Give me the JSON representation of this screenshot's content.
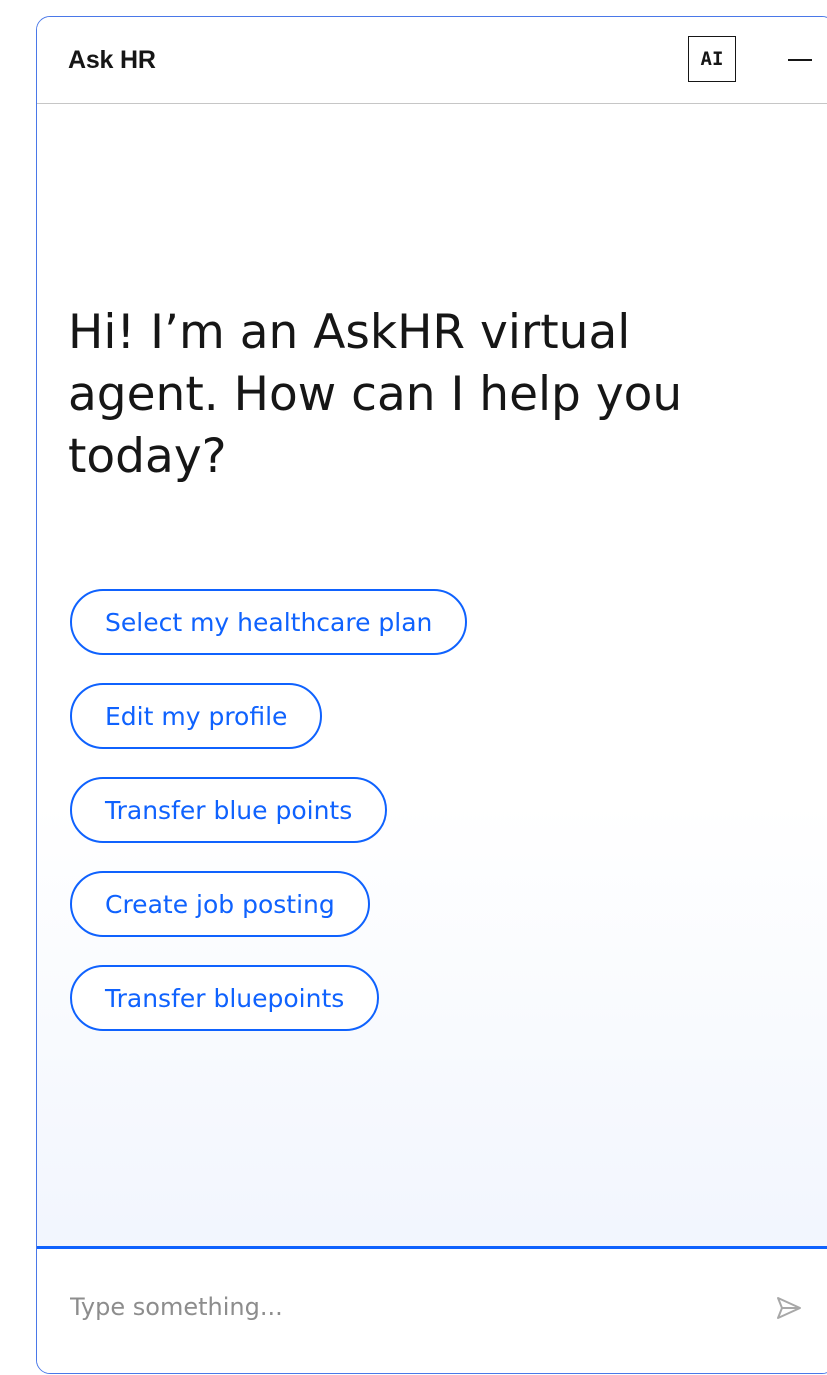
{
  "header": {
    "title": "Ask HR",
    "ai_badge": "AI",
    "minimize_icon": "minimize-icon"
  },
  "greeting": {
    "text": "Hi! I’m an AskHR virtual agent. How can I help you today?"
  },
  "suggestions": [
    {
      "label": "Select my healthcare plan"
    },
    {
      "label": "Edit my profile"
    },
    {
      "label": "Transfer blue points"
    },
    {
      "label": "Create job posting"
    },
    {
      "label": "Transfer bluepoints"
    }
  ],
  "composer": {
    "placeholder": "Type something...",
    "value": "",
    "send_icon": "send-icon"
  },
  "colors": {
    "accent": "#0f62fe",
    "border": "#4a78e8",
    "text": "#161616",
    "placeholder": "#8d8d8d"
  }
}
